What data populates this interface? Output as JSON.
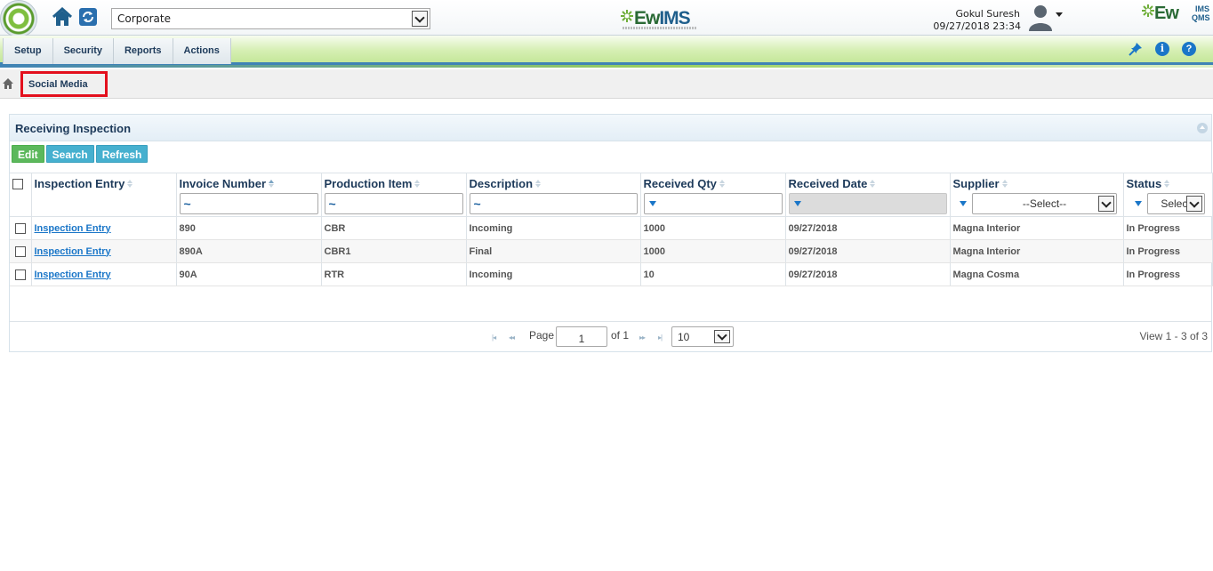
{
  "header": {
    "org_select_value": "Corporate",
    "brand_center_ew": "Ew",
    "brand_center_ims": "IMS",
    "brand_right_ew": "Ew",
    "brand_right_ims": "IMS",
    "brand_right_qms": "QMS",
    "user_name": "Gokul Suresh",
    "user_datetime": "09/27/2018 23:34"
  },
  "menu": {
    "items": [
      "Setup",
      "Security",
      "Reports",
      "Actions"
    ]
  },
  "breadcrumb": {
    "current": "Social Media"
  },
  "panel": {
    "title": "Receiving Inspection",
    "buttons": {
      "edit": "Edit",
      "search": "Search",
      "refresh": "Refresh"
    }
  },
  "grid": {
    "columns": [
      "Inspection Entry",
      "Invoice Number",
      "Production Item",
      "Description",
      "Received Qty",
      "Received Date",
      "Supplier",
      "Status"
    ],
    "filters": {
      "invoice_number": "~",
      "production_item": "~",
      "description": "~",
      "supplier_select": "--Select--",
      "status_select": "Select"
    },
    "rows": [
      {
        "entry": "Inspection Entry",
        "invoice": "890",
        "item": "CBR",
        "description": "Incoming",
        "qty": "1000",
        "date": "09/27/2018",
        "supplier": "Magna Interior",
        "status": "In Progress"
      },
      {
        "entry": "Inspection Entry",
        "invoice": "890A",
        "item": "CBR1",
        "description": "Final",
        "qty": "1000",
        "date": "09/27/2018",
        "supplier": "Magna Interior",
        "status": "In Progress"
      },
      {
        "entry": "Inspection Entry",
        "invoice": "90A",
        "item": "RTR",
        "description": "Incoming",
        "qty": "10",
        "date": "09/27/2018",
        "supplier": "Magna Cosma",
        "status": "In Progress"
      }
    ]
  },
  "pager": {
    "page_label": "Page",
    "page_value": "1",
    "of_label": "of 1",
    "page_size": "10",
    "view_text": "View 1 - 3 of 3"
  }
}
